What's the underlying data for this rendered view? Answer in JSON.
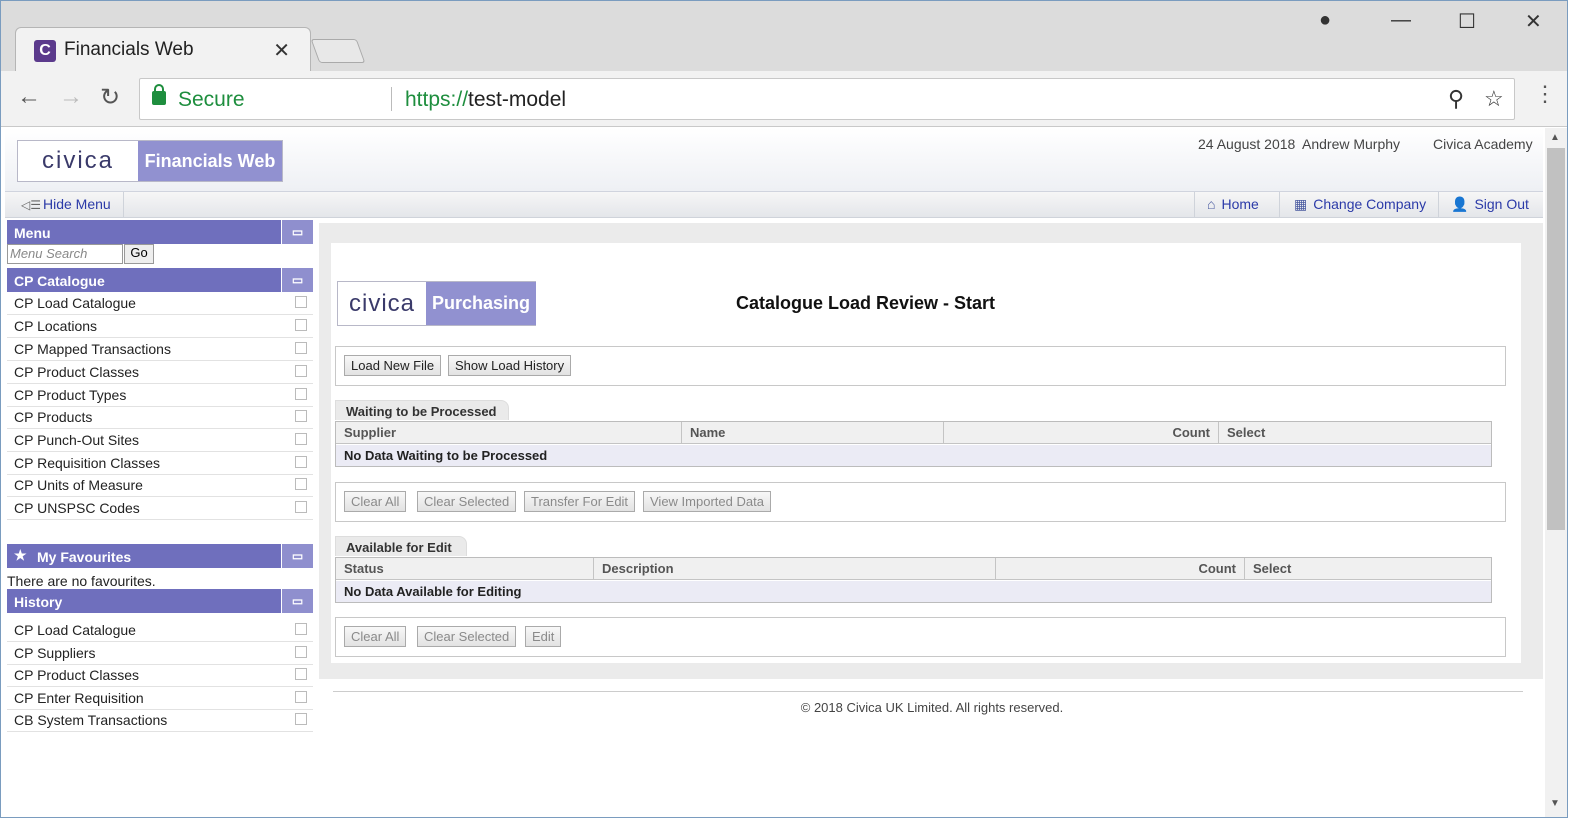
{
  "browser": {
    "tab_title": "Financials Web",
    "favicon_letter": "C",
    "secure_label": "Secure",
    "url_scheme": "https://",
    "url_host": "test-model"
  },
  "header": {
    "logo_civica": "civica",
    "logo_product": "Financials Web",
    "date": "24 August 2018",
    "user": "Andrew Murphy",
    "company": "Civica Academy"
  },
  "navbar": {
    "hide_menu": "Hide Menu",
    "home": "Home",
    "change_company": "Change Company",
    "sign_out": "Sign Out"
  },
  "sidebar": {
    "menu_title": "Menu",
    "search_placeholder": "Menu Search",
    "go": "Go",
    "catalogue_title": "CP Catalogue",
    "catalogue_items": [
      "CP Load Catalogue",
      "CP Locations",
      "CP Mapped Transactions",
      "CP Product Classes",
      "CP Product Types",
      "CP Products",
      "CP Punch-Out Sites",
      "CP Requisition Classes",
      "CP Units of Measure",
      "CP UNSPSC Codes"
    ],
    "favourites_title": "My Favourites",
    "no_favourites": "There are no favourites.",
    "history_title": "History",
    "history_items": [
      "CP Load Catalogue",
      "CP Suppliers",
      "CP Product Classes",
      "CP Enter Requisition",
      "CB System Transactions"
    ]
  },
  "main": {
    "logo_civica": "civica",
    "logo_module": "Purchasing",
    "title": "Catalogue Load Review - Start",
    "load_new_file": "Load New File",
    "show_load_history": "Show Load History",
    "waiting": {
      "caption": "Waiting to be Processed",
      "columns": [
        "Supplier",
        "Name",
        "Count",
        "Select"
      ],
      "empty": "No Data Waiting to be Processed",
      "buttons": [
        "Clear All",
        "Clear Selected",
        "Transfer For Edit",
        "View Imported Data"
      ]
    },
    "available": {
      "caption": "Available for Edit",
      "columns": [
        "Status",
        "Description",
        "Count",
        "Select"
      ],
      "empty": "No Data Available for Editing",
      "buttons": [
        "Clear All",
        "Clear Selected",
        "Edit"
      ]
    }
  },
  "footer": "© 2018 Civica UK Limited. All rights reserved."
}
